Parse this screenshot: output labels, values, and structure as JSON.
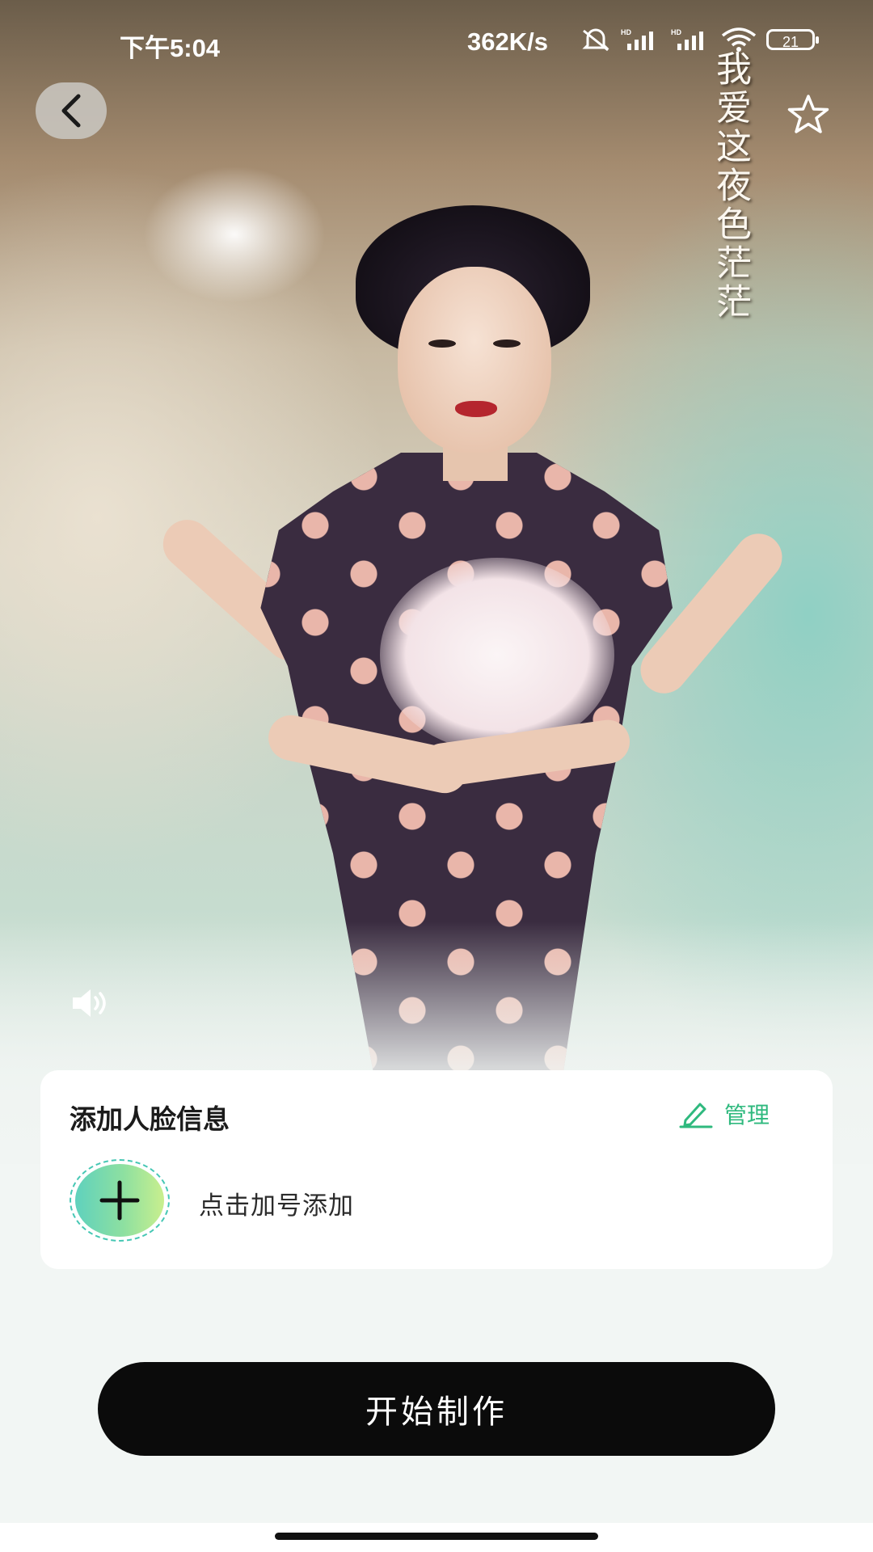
{
  "status_bar": {
    "time": "下午5:04",
    "network_speed": "362K/s",
    "battery_level": "21",
    "icons": [
      "alarm-off-icon",
      "hd-signal-icon",
      "hd-signal-icon",
      "wifi-icon",
      "battery-icon"
    ]
  },
  "video": {
    "overlay_text": "我爱这夜色茫茫",
    "controls": [
      "back-icon",
      "star-icon",
      "volume-icon"
    ]
  },
  "face_card": {
    "title": "添加人脸信息",
    "manage_label": "管理",
    "add_hint": "点击加号添加"
  },
  "actions": {
    "start_label": "开始制作"
  },
  "colors": {
    "accent_green": "#2fb97e",
    "start_button": "#0b0b0b",
    "card_bg": "#ffffff",
    "page_bg": "#f2f6f4"
  }
}
